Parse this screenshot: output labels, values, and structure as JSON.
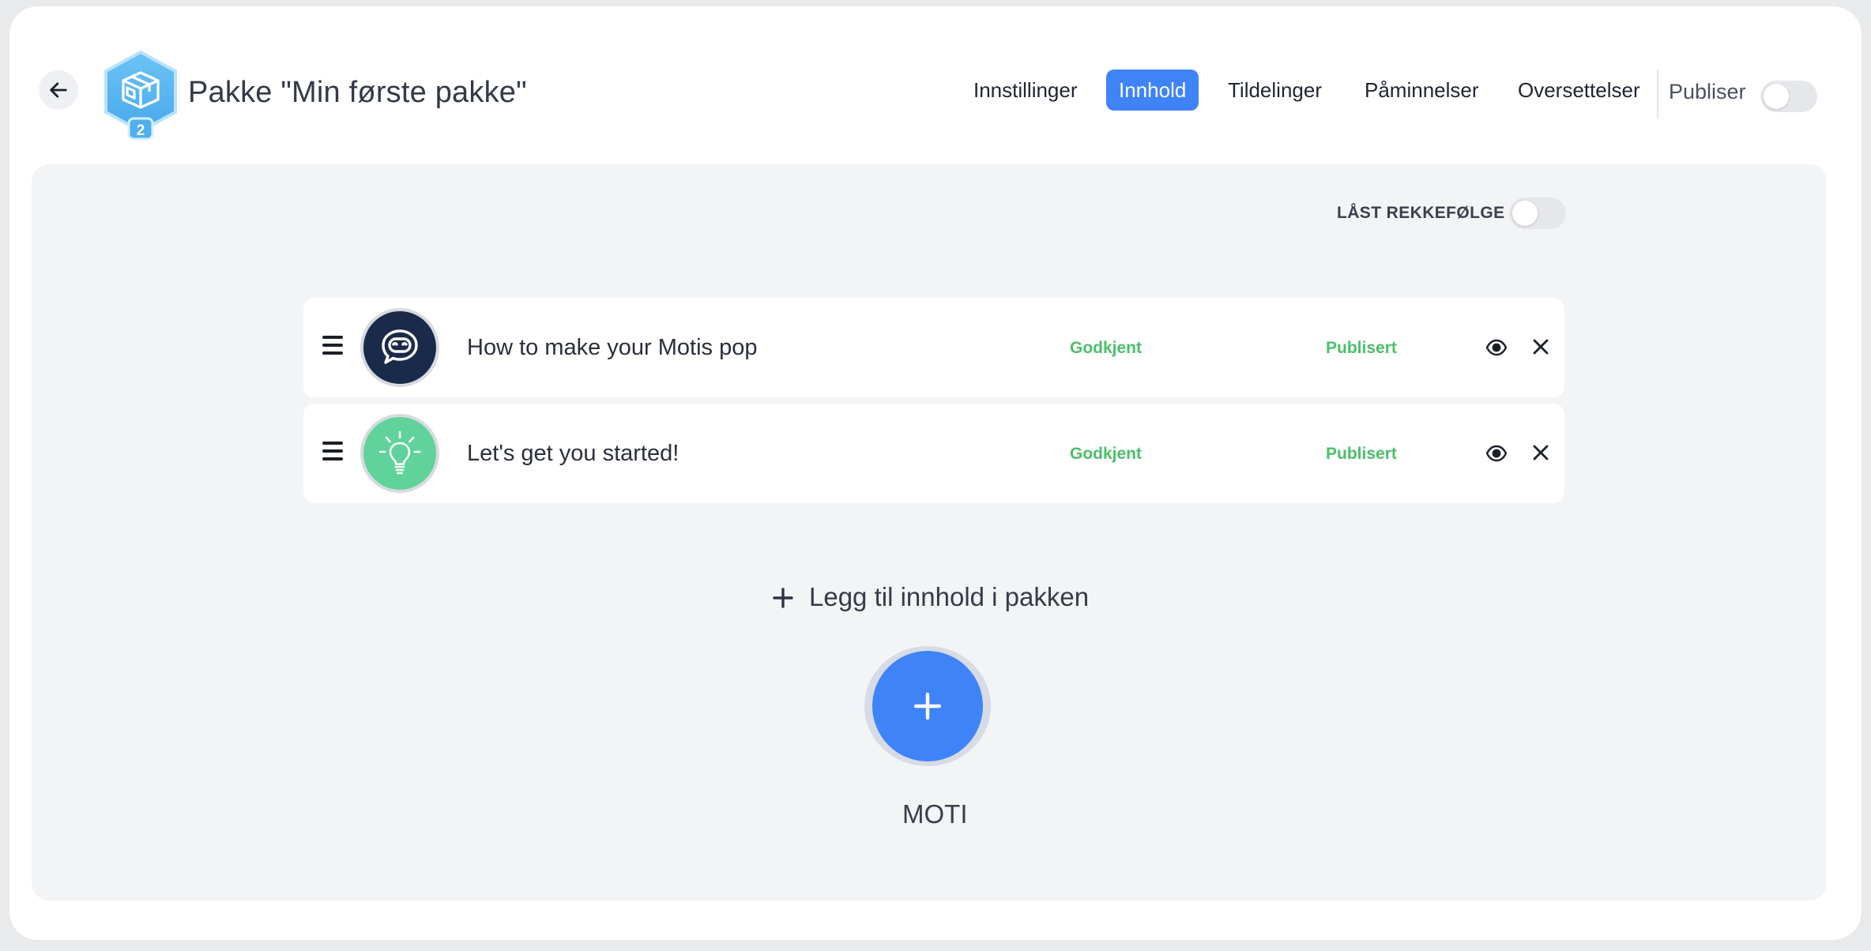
{
  "header": {
    "title": "Pakke \"Min første pakke\"",
    "badge_count": "2",
    "tabs": [
      {
        "label": "Innstillinger",
        "active": false
      },
      {
        "label": "Innhold",
        "active": true
      },
      {
        "label": "Tildelinger",
        "active": false
      },
      {
        "label": "Påminnelser",
        "active": false
      },
      {
        "label": "Oversettelser",
        "active": false
      }
    ],
    "publish_label": "Publiser",
    "publish_on": false
  },
  "content": {
    "locked_order_label": "LÅST REKKEFØLGE",
    "locked_order_on": false,
    "items": [
      {
        "title": "How to make your Motis pop",
        "approval": "Godkjent",
        "status": "Publisert",
        "icon": "chat-bot-icon",
        "color": "#1a2a4a"
      },
      {
        "title": "Let's get you started!",
        "approval": "Godkjent",
        "status": "Publisert",
        "icon": "lightbulb-icon",
        "color": "#5fd39a"
      }
    ],
    "add_label": "Legg til innhold i pakken",
    "add_type_label": "MOTI"
  },
  "colors": {
    "accent": "#3f83f8",
    "status_green": "#4bbf6b",
    "panel_bg": "#f3f4f6"
  }
}
